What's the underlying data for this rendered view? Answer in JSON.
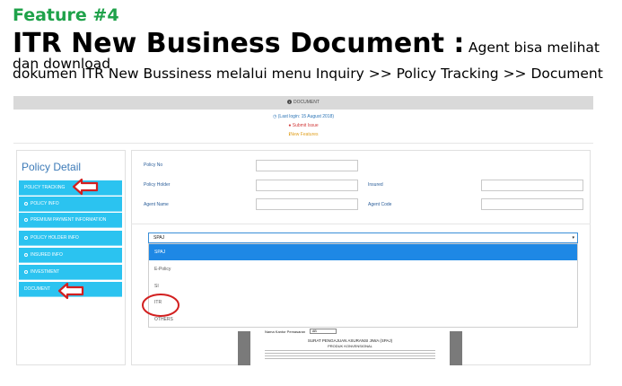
{
  "feature_tag": "Feature #4",
  "headline": {
    "main": "ITR New Business Document :",
    "rest": "Agent bisa melihat dan download",
    "line2": "dokumen ITR New Bussiness melalui menu Inquiry >> Policy Tracking >> Document"
  },
  "app": {
    "doc_bar_label": "DOCUMENT",
    "last_login": "(Last login: 15 August 2018)",
    "submit_issue": "Submit Issue",
    "new_features": "New Features",
    "sidebar": {
      "title": "Policy Detail",
      "items": [
        {
          "label": "POLICY TRACKING"
        },
        {
          "label": "POLICY INFO"
        },
        {
          "label": "PREMIUM PAYMENT INFORMATION"
        },
        {
          "label": "POLICY HOLDER INFO"
        },
        {
          "label": "INSURED INFO"
        },
        {
          "label": "INVESTMENT"
        },
        {
          "label": "DOCUMENT"
        }
      ]
    },
    "form": {
      "policy_no_label": "Policy No",
      "policy_holder_label": "Policy Holder",
      "insured_label": "Insured",
      "agent_name_label": "Agent Name",
      "agent_code_label": "Agent Code"
    },
    "dropdown": {
      "selected": "SPAJ",
      "caret": "▾",
      "options": [
        "SPAJ",
        "E-Policy",
        "SI",
        "ITR",
        "OTHERS"
      ]
    },
    "preview": {
      "field_label": "Nama Kantor Pemasaran",
      "field_value": "AB",
      "doc_title": "SURAT PENGAJUAN ASURANSI JIWA (SPAJ)",
      "doc_subtitle": "PRODUK KONVENSIONAL"
    }
  },
  "colors": {
    "feature_green": "#1fa24a",
    "nav_cyan": "#2bc3f0",
    "selected_blue": "#1e88e5",
    "annotation_red": "#d21f1f"
  }
}
